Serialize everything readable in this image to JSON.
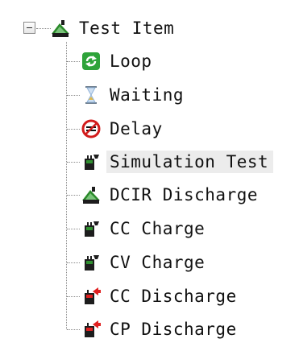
{
  "tree": {
    "root": {
      "label": "Test Item",
      "expanded": true,
      "icon": "battery-cell-icon"
    },
    "items": [
      {
        "label": "Loop",
        "icon": "loop-arrows-icon",
        "color": "#2ea33a"
      },
      {
        "label": "Waiting",
        "icon": "hourglass-icon",
        "color": "#8fb2d8"
      },
      {
        "label": "Delay",
        "icon": "no-entry-icon",
        "color": "#d21b1b"
      },
      {
        "label": "Simulation Test",
        "icon": "battery-plug-icon",
        "color": "#2f8f2f",
        "selected": true
      },
      {
        "label": "DCIR Discharge",
        "icon": "battery-cell-icon",
        "color": "#2f8f2f"
      },
      {
        "label": "CC Charge",
        "icon": "battery-plug-icon",
        "color": "#2f8f2f"
      },
      {
        "label": "CV Charge",
        "icon": "battery-plug-icon",
        "color": "#2f8f2f"
      },
      {
        "label": "CC Discharge",
        "icon": "battery-discharge-icon",
        "color": "#e02020"
      },
      {
        "label": "CP Discharge",
        "icon": "battery-discharge-icon",
        "color": "#e02020"
      }
    ]
  }
}
